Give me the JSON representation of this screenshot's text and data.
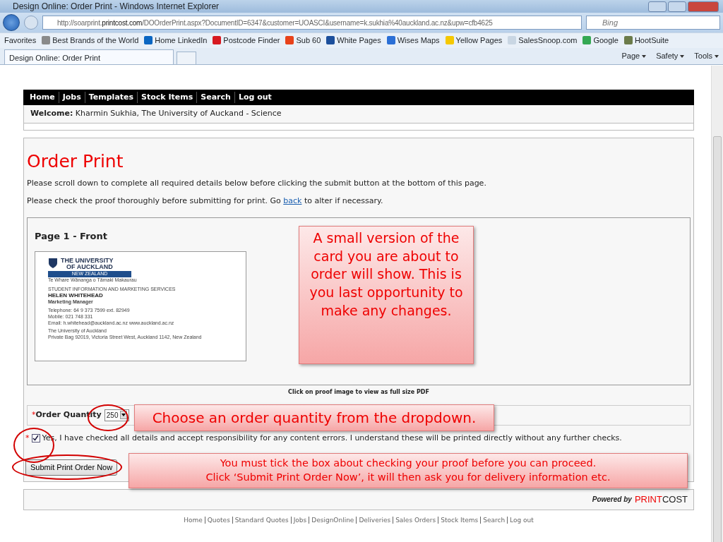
{
  "window": {
    "title": "Design Online: Order Print - Windows Internet Explorer"
  },
  "browser": {
    "address_host": "http://soarprint.",
    "address_domain": "printcost.com",
    "address_path": "/DOOrderPrint.aspx?DocumentID=6347&customer=UOASCI&username=k.sukhia%40auckland.ac.nz&upw=cfb4625",
    "search_placeholder": "Bing",
    "favorites_label": "Favorites",
    "favorites": [
      {
        "label": "Best Brands of the World",
        "color": "#8a8a8a"
      },
      {
        "label": "Home LinkedIn",
        "color": "#0a66c2"
      },
      {
        "label": "Postcode Finder",
        "color": "#d71920"
      },
      {
        "label": "Sub 60",
        "color": "#e8421a"
      },
      {
        "label": "White Pages",
        "color": "#1c4f9c"
      },
      {
        "label": "Wises Maps",
        "color": "#2b6fd6"
      },
      {
        "label": "Yellow Pages",
        "color": "#f5c800"
      },
      {
        "label": "SalesSnoop.com",
        "color": "#c9d6e3"
      },
      {
        "label": "Google",
        "color": "#34a853"
      },
      {
        "label": "HootSuite",
        "color": "#6b7b4a"
      }
    ],
    "tab_title": "Design Online: Order Print",
    "commands": [
      "Page",
      "Safety",
      "Tools"
    ]
  },
  "site": {
    "nav": [
      "Home",
      "Jobs",
      "Templates",
      "Stock Items",
      "Search",
      "Log out"
    ],
    "welcome_label": "Welcome:",
    "welcome_text": "Kharmin Sukhia, The University of Auckand - Science",
    "heading": "Order Print",
    "intro": "Please scroll down to complete all required details below before clicking the submit button at the bottom of this page.",
    "proof_note_before": "Please check the proof thoroughly before submitting for print. Go",
    "proof_note_link": "back",
    "proof_note_after": "to alter if necessary.",
    "proof_title": "Page 1 - Front",
    "card": {
      "logo_line1": "THE UNIVERSITY",
      "logo_line2": "OF AUCKLAND",
      "logo_band": "NEW ZEALAND",
      "motto": "Te Whare Wānanga o Tāmaki Makaurau",
      "department": "STUDENT INFORMATION AND MARKETING SERVICES",
      "name": "HELEN WHITEHEAD",
      "role": "Marketing Manager",
      "lines": [
        "Telephone: 64 9 373 7599 ext. 82949",
        "Mobile: 021 748 331",
        "Email: h.whitehead@auckland.ac.nz  www.auckland.ac.nz"
      ],
      "address": [
        "The University of Auckland",
        "Private Bag 92019, Victoria Street West, Auckland 1142, New Zealand"
      ]
    },
    "proof_caption": "Click on proof image to view as full size PDF",
    "quantity_label": "Order Quantity",
    "quantity_value": "250",
    "required_mark": "*",
    "agree": {
      "checked": true,
      "text": "Yes, I have checked all details and accept responsibility for any content errors. I understand these will be printed directly without any further checks."
    },
    "submit": "Submit Print Order Now",
    "powered_by": "Powered by",
    "brand_a": "PRINT",
    "brand_b": "COST",
    "footer_links": [
      "Home",
      "Quotes",
      "Standard Quotes",
      "Jobs",
      "DesignOnline",
      "Deliveries",
      "Sales Orders",
      "Stock Items",
      "Search",
      "Log out"
    ]
  },
  "callouts": [
    {
      "kind": "proof",
      "text": "A small version of the card you are about to order will show. This is you last opportunity to make any changes."
    },
    {
      "kind": "quantity",
      "text": "Choose an order quantity from the dropdown."
    },
    {
      "kind": "submit",
      "lines": [
        "You must tick the box about checking your proof before you can proceed.",
        "Click ‘Submit Print Order Now’, it will then ask you for delivery information etc."
      ]
    }
  ]
}
